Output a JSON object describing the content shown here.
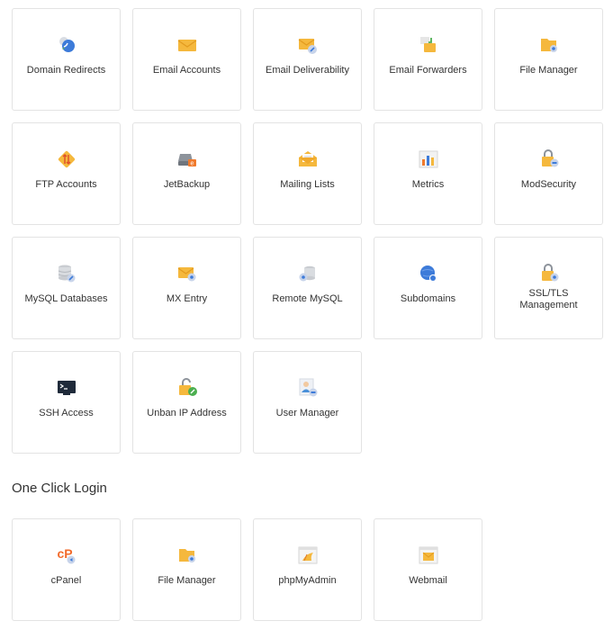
{
  "tools": [
    {
      "label": "Domain Redirects",
      "icon": "globe-redirect-icon"
    },
    {
      "label": "Email Accounts",
      "icon": "envelope-icon"
    },
    {
      "label": "Email Deliverability",
      "icon": "envelope-key-icon"
    },
    {
      "label": "Email Forwarders",
      "icon": "envelope-forward-icon"
    },
    {
      "label": "File Manager",
      "icon": "folder-icon"
    },
    {
      "label": "FTP Accounts",
      "icon": "ftp-transfer-icon"
    },
    {
      "label": "JetBackup",
      "icon": "backup-drive-icon"
    },
    {
      "label": "Mailing Lists",
      "icon": "open-envelope-icon"
    },
    {
      "label": "Metrics",
      "icon": "bar-chart-icon"
    },
    {
      "label": "ModSecurity",
      "icon": "lock-shield-icon"
    },
    {
      "label": "MySQL Databases",
      "icon": "database-icon"
    },
    {
      "label": "MX Entry",
      "icon": "envelope-gear-icon"
    },
    {
      "label": "Remote MySQL",
      "icon": "remote-database-icon"
    },
    {
      "label": "Subdomains",
      "icon": "globe-icon"
    },
    {
      "label": "SSL/TLS Management",
      "icon": "ssl-lock-icon"
    },
    {
      "label": "SSH Access",
      "icon": "terminal-icon"
    },
    {
      "label": "Unban IP Address",
      "icon": "unban-lock-icon"
    },
    {
      "label": "User Manager",
      "icon": "user-manager-icon"
    }
  ],
  "one_click": {
    "title": "One Click Login",
    "items": [
      {
        "label": "cPanel",
        "icon": "cpanel-logo-icon"
      },
      {
        "label": "File Manager",
        "icon": "folder-icon"
      },
      {
        "label": "phpMyAdmin",
        "icon": "phpmyadmin-icon"
      },
      {
        "label": "Webmail",
        "icon": "webmail-icon"
      }
    ]
  },
  "colors": {
    "orange": "#f5b83d",
    "blue": "#3d7bd9",
    "border": "#e3e3e3",
    "text": "#333333"
  }
}
